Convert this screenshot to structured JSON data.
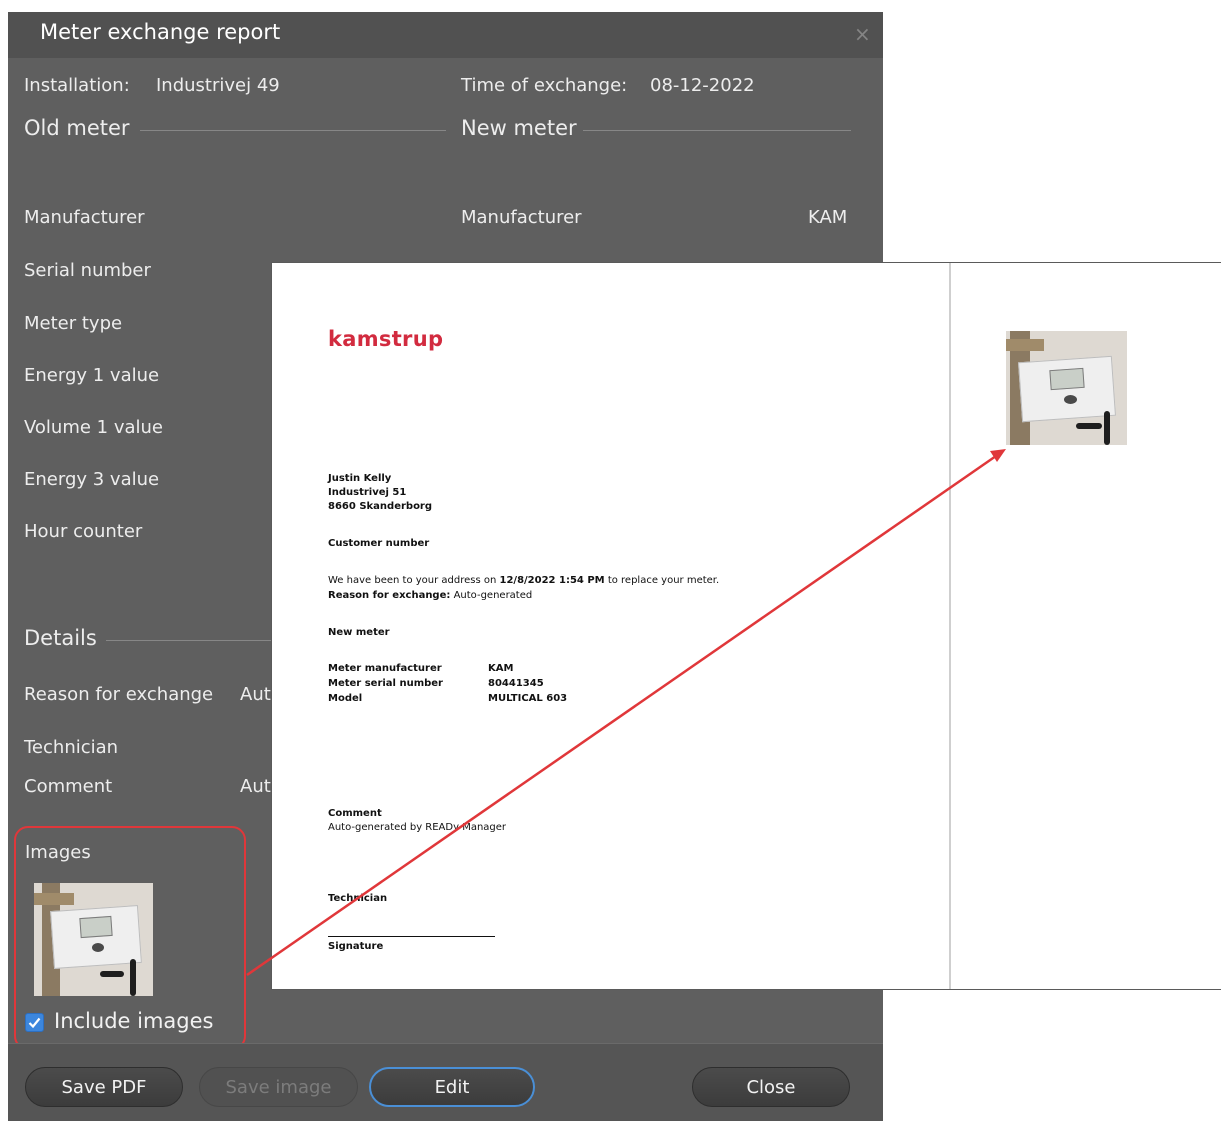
{
  "dialog": {
    "title": "Meter exchange report",
    "close_symbol": "×",
    "installation_label": "Installation:",
    "installation_value": "Industrivej 49",
    "time_label": "Time of exchange:",
    "time_value": "08-12-2022",
    "old_meter_heading": "Old meter",
    "new_meter_heading": "New meter",
    "old_fields": [
      "Manufacturer",
      "Serial number",
      "Meter type",
      "Energy 1 value",
      "Volume 1 value",
      "Energy 3 value",
      "Hour counter"
    ],
    "new_manufacturer_label": "Manufacturer",
    "new_manufacturer_value": "KAM",
    "details_heading": "Details",
    "reason_label": "Reason for exchange",
    "reason_value_partial": "Aut",
    "technician_label": "Technician",
    "comment_label": "Comment",
    "comment_value_partial": "Aut",
    "images_label": "Images",
    "include_images_label": "Include images",
    "include_images_checked": true,
    "buttons": {
      "save_pdf": "Save PDF",
      "save_image": "Save image",
      "edit": "Edit",
      "close": "Close"
    }
  },
  "preview": {
    "brand": "kamstrup",
    "address": [
      "Justin Kelly",
      "Industrivej 51",
      "8660 Skanderborg"
    ],
    "customer_number_label": "Customer number",
    "visit_prefix": "We have been to your address on ",
    "visit_datetime": "12/8/2022 1:54 PM",
    "visit_suffix": " to replace your meter.",
    "reason_label": "Reason for exchange:",
    "reason_value": "Auto-generated",
    "new_meter_heading": "New meter",
    "meter_rows": [
      {
        "label": "Meter manufacturer",
        "value": "KAM"
      },
      {
        "label": "Meter serial number",
        "value": "80441345"
      },
      {
        "label": "Model",
        "value": "MULTICAL 603"
      }
    ],
    "comment_label": "Comment",
    "comment_value": "Auto-generated by READy Manager",
    "technician_label": "Technician",
    "signature_label": "Signature"
  },
  "colors": {
    "dialog_bg": "#5f5f5f",
    "titlebar_bg": "#515151",
    "highlight_red": "#e0373a",
    "brand_red": "#d22b3f",
    "checkbox_blue": "#3c86dd"
  }
}
